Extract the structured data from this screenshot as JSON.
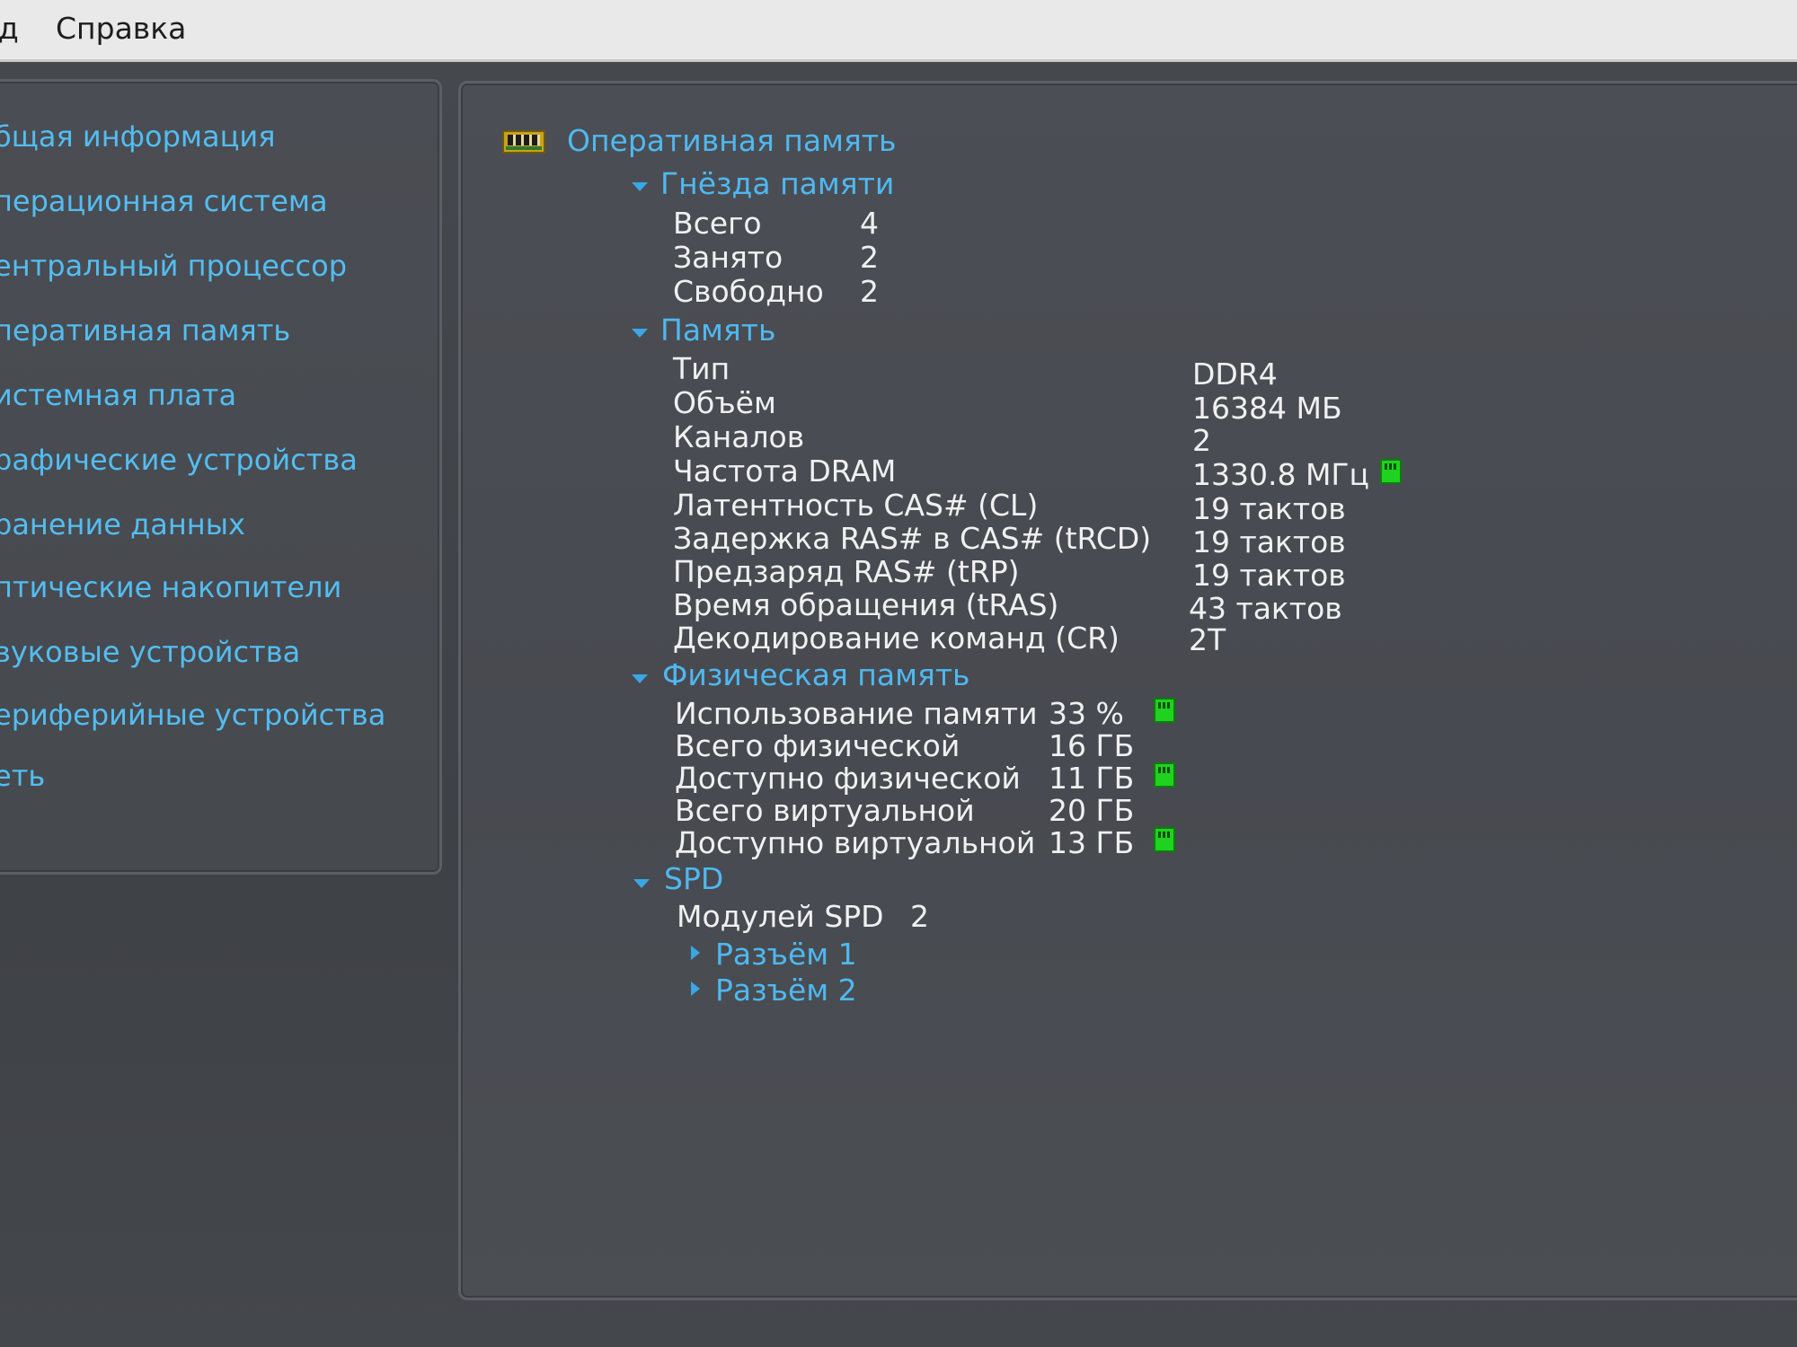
{
  "menu": {
    "left_fragment": "д",
    "help": "Справка"
  },
  "sidebar": {
    "items": [
      {
        "label": "бщая информация"
      },
      {
        "label": "перационная система"
      },
      {
        "label": "ентральный процессор"
      },
      {
        "label": "перативная память"
      },
      {
        "label": "истемная плата"
      },
      {
        "label": "рафические устройства"
      },
      {
        "label": "ранение данных"
      },
      {
        "label": "птические накопители"
      },
      {
        "label": "вуковые устройства"
      },
      {
        "label": "ериферийные устройства"
      },
      {
        "label": "еть"
      }
    ]
  },
  "main": {
    "title": "Оперативная память",
    "slots": {
      "header": "Гнёзда памяти",
      "rows": [
        {
          "label": "Всего",
          "value": "4"
        },
        {
          "label": "Занято",
          "value": "2"
        },
        {
          "label": "Свободно",
          "value": "2"
        }
      ]
    },
    "memory": {
      "header": "Память",
      "rows": [
        {
          "label": "Тип",
          "value": "DDR4"
        },
        {
          "label": "Объём",
          "value": "16384 МБ"
        },
        {
          "label": "Каналов",
          "value": "2"
        },
        {
          "label": "Частота DRAM",
          "value": "1330.8 МГц"
        },
        {
          "label": "Латентность CAS# (CL)",
          "value": "19 тактов"
        },
        {
          "label": "Задержка RAS# в CAS# (tRCD)",
          "value": "19 тактов"
        },
        {
          "label": "Предзаряд RAS# (tRP)",
          "value": "19 тактов"
        },
        {
          "label": "Время обращения (tRAS)",
          "value": "43 тактов"
        },
        {
          "label": "Декодирование команд (CR)",
          "value": "2T"
        }
      ]
    },
    "physical": {
      "header": "Физическая память",
      "rows": [
        {
          "label": "Использование памяти",
          "value": "33 %"
        },
        {
          "label": "Всего физической",
          "value": "16 ГБ"
        },
        {
          "label": "Доступно физической",
          "value": "11 ГБ"
        },
        {
          "label": "Всего виртуальной",
          "value": "20 ГБ"
        },
        {
          "label": "Доступно виртуальной",
          "value": "13 ГБ"
        }
      ]
    },
    "spd": {
      "header": "SPD",
      "modules_label": "Модулей SPD",
      "modules_value": "2",
      "slots": [
        {
          "label": "Разъём 1"
        },
        {
          "label": "Разъём 2"
        }
      ]
    }
  },
  "colors": {
    "link_blue": "#53bdf1",
    "gauge_green": "#1fd21f",
    "panel_bg": "#4a4d53"
  },
  "icons": {
    "ram": "ram-module-icon",
    "gauge": "status-gauge-icon",
    "expanded": "chevron-down-icon",
    "collapsed": "chevron-right-icon"
  }
}
